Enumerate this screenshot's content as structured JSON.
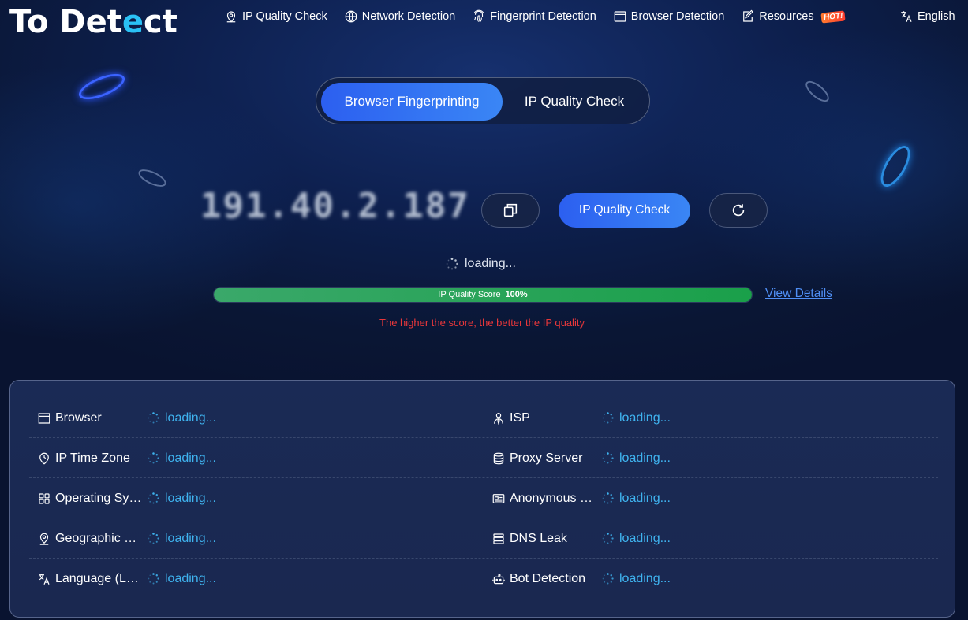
{
  "header": {
    "logo_text_a": "To Det",
    "logo_text_b": "e",
    "logo_text_c": "ct",
    "nav": [
      {
        "label": "IP Quality Check",
        "icon": "location-pin-icon"
      },
      {
        "label": "Network Detection",
        "icon": "globe-icon"
      },
      {
        "label": "Fingerprint Detection",
        "icon": "fingerprint-icon"
      },
      {
        "label": "Browser Detection",
        "icon": "browser-window-icon"
      },
      {
        "label": "Resources",
        "icon": "edit-document-icon",
        "badge": "HOT!"
      }
    ],
    "language": "English"
  },
  "toggle": {
    "active": "Browser Fingerprinting",
    "other": "IP Quality Check"
  },
  "ip": {
    "address": "191.40.2.187",
    "check_label": "IP Quality Check",
    "status": "loading..."
  },
  "score": {
    "label": "IP Quality Score",
    "value_text": "100%",
    "value": 100,
    "details_link": "View Details",
    "hint": "The higher the score, the better the IP quality"
  },
  "info": {
    "left": [
      {
        "label": "Browser",
        "value": "loading...",
        "icon": "browser-window-icon"
      },
      {
        "label": "IP Time Zone",
        "value": "loading...",
        "icon": "clock-icon"
      },
      {
        "label": "Operating System",
        "value": "loading...",
        "icon": "grid-icon"
      },
      {
        "label": "Geographic Location",
        "value": "loading...",
        "icon": "location-pin-icon"
      },
      {
        "label": "Language (Locale)",
        "value": "loading...",
        "icon": "translate-icon"
      }
    ],
    "right": [
      {
        "label": "ISP",
        "value": "loading...",
        "icon": "user-icon"
      },
      {
        "label": "Proxy Server",
        "value": "loading...",
        "icon": "database-icon"
      },
      {
        "label": "Anonymous Server",
        "value": "loading...",
        "icon": "id-card-icon"
      },
      {
        "label": "DNS Leak",
        "value": "loading...",
        "icon": "server-list-icon"
      },
      {
        "label": "Bot Detection",
        "value": "loading...",
        "icon": "robot-icon"
      }
    ]
  },
  "colors": {
    "accent": "#2c5ff0",
    "loading": "#3fb4f0",
    "score_fill": "#1aa04a",
    "hint": "#e8373a",
    "link": "#4f8ff5"
  }
}
